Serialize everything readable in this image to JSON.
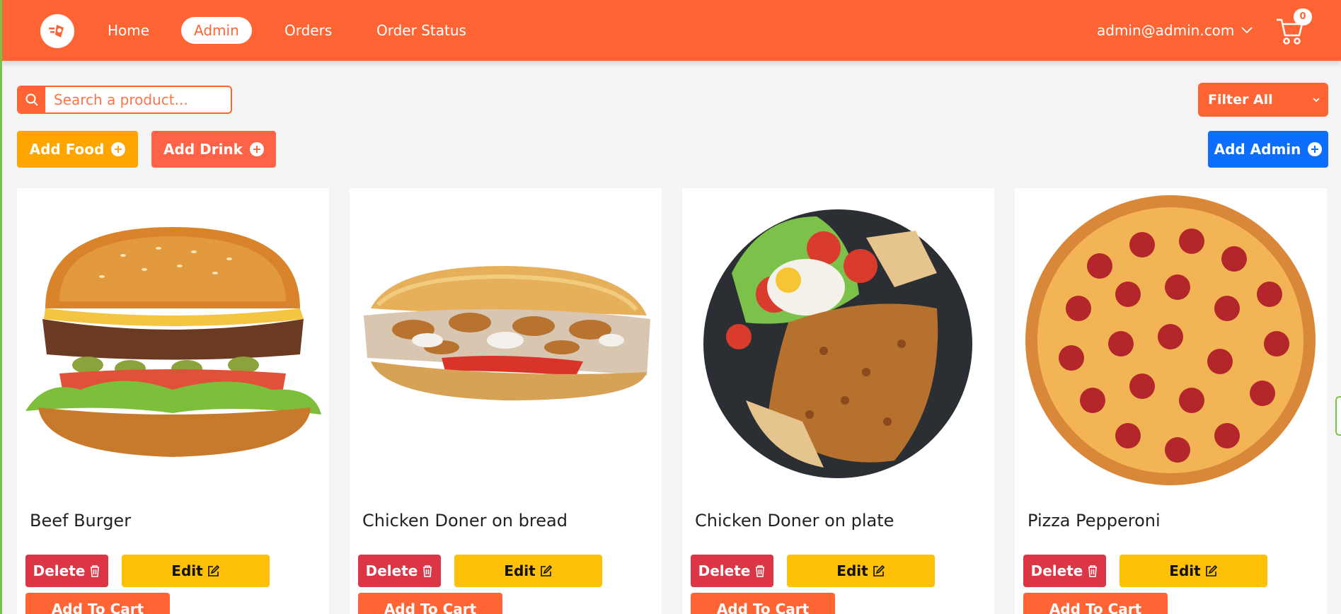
{
  "nav": {
    "links": [
      "Home",
      "Admin",
      "Orders",
      "Order Status"
    ],
    "user_email": "admin@admin.com",
    "cart_count": "0"
  },
  "toolbar": {
    "search_placeholder": "Search a product...",
    "filter_label": "Filter All",
    "add_food_label": "Add Food",
    "add_drink_label": "Add Drink",
    "add_admin_label": "Add Admin"
  },
  "products": [
    {
      "name": "Beef Burger"
    },
    {
      "name": "Chicken Doner on bread"
    },
    {
      "name": "Chicken Doner on plate"
    },
    {
      "name": "Pizza Pepperoni"
    }
  ],
  "card_actions": {
    "delete_label": "Delete",
    "edit_label": "Edit",
    "add_to_cart_label": "Add To Cart"
  },
  "colors": {
    "brand": "#ff6435",
    "food": "#ffa500",
    "drink": "#ff6347",
    "admin": "#0d6efd",
    "delete": "#dc3545",
    "edit": "#ffc107"
  }
}
